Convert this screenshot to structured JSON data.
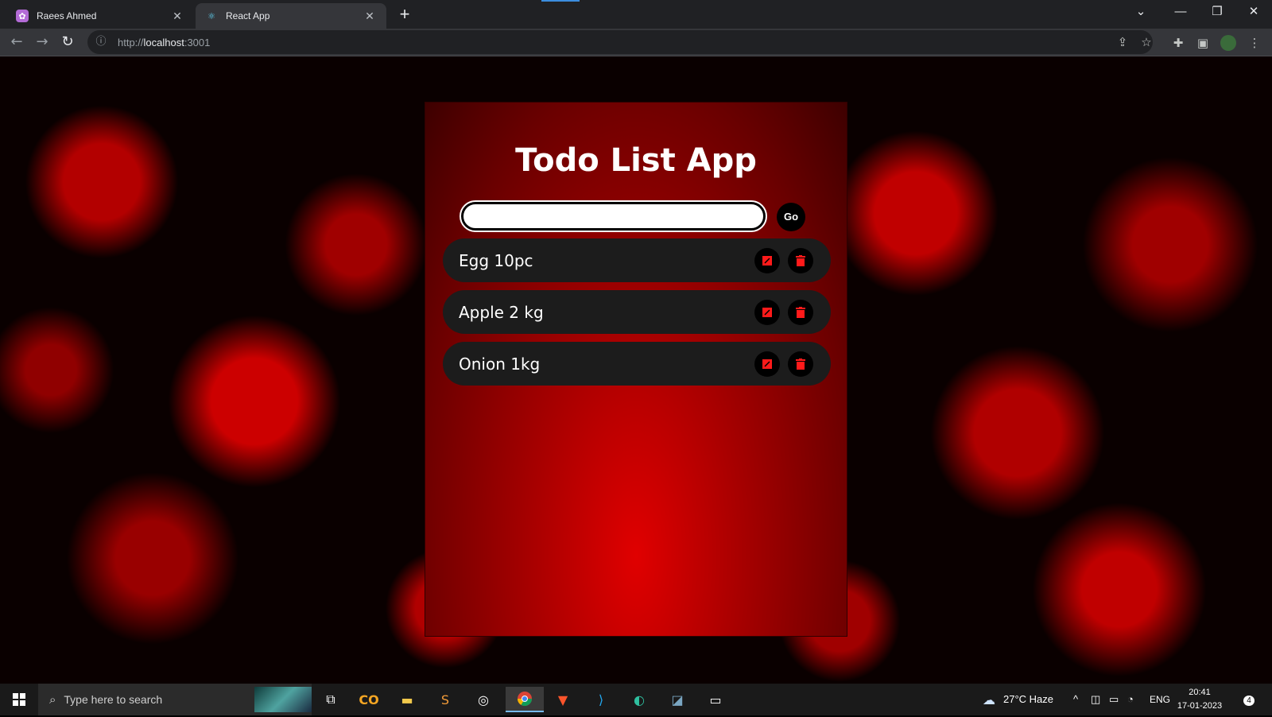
{
  "browser": {
    "tabs": [
      {
        "title": "Raees Ahmed",
        "close": "✕"
      },
      {
        "title": "React App",
        "close": "✕"
      }
    ],
    "new_tab": "+",
    "url_scheme": "http://",
    "url_host": "localhost",
    "url_port": ":3001",
    "window_controls": {
      "minimize": "—",
      "restore": "❐",
      "close": "✕"
    }
  },
  "app": {
    "title": "Todo List App",
    "input_value": "",
    "go_label": "Go",
    "todos": [
      {
        "text": "Egg 10pc"
      },
      {
        "text": "Apple 2 kg"
      },
      {
        "text": "Onion 1kg"
      }
    ]
  },
  "taskbar": {
    "search_placeholder": "Type here to search",
    "weather": "27°C  Haze",
    "language": "ENG",
    "time": "20:41",
    "date": "17-01-2023",
    "notifications": "4"
  },
  "colors": {
    "accent": "#ff0000",
    "card_center": "#e00000",
    "item_bg": "#1c1c1c"
  }
}
